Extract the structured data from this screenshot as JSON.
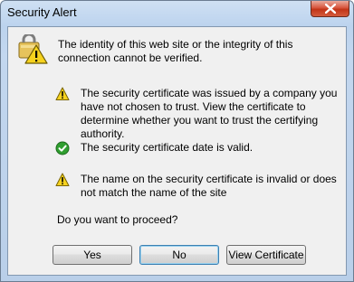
{
  "window": {
    "title": "Security Alert"
  },
  "header": {
    "message": "The identity of this web site or the integrity of this connection cannot be verified."
  },
  "items": [
    {
      "icon": "warning-icon",
      "text": "The security certificate was issued by a company you have not chosen to trust. View the certificate to determine whether you want to trust the certifying authority."
    },
    {
      "icon": "check-icon",
      "text": "The security certificate date is valid."
    },
    {
      "icon": "warning-icon",
      "text": "The name on the security certificate is invalid or does not match the name of the site"
    }
  ],
  "question": "Do you want to proceed?",
  "buttons": {
    "yes": "Yes",
    "no": "No",
    "view_certificate": "View Certificate"
  },
  "colors": {
    "warning": "#f6d21e",
    "ok": "#2f9e2f",
    "close": "#c9432a"
  }
}
